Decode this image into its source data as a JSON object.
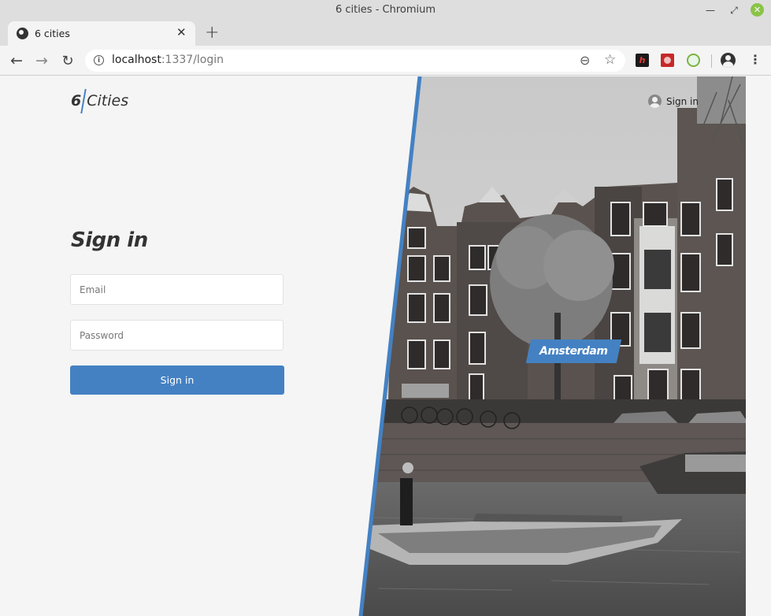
{
  "window": {
    "title": "6 cities - Chromium"
  },
  "tab": {
    "label": "6 cities",
    "close_glyph": "✕",
    "new_tab_glyph": "+"
  },
  "toolbar": {
    "back_glyph": "←",
    "forward_glyph": "→",
    "reload_glyph": "↻",
    "url_host": "localhost",
    "url_rest": ":1337/login",
    "zoom_glyph": "⊖",
    "bookmark_glyph": "☆",
    "menu_glyph": "⋮",
    "extension_1_letter": "h"
  },
  "page": {
    "logo": {
      "number": "6",
      "word": "Cities"
    },
    "header": {
      "sign_in_label": "Sign in"
    },
    "login": {
      "title": "Sign in",
      "email_placeholder": "Email",
      "password_placeholder": "Password",
      "submit_label": "Sign in"
    },
    "city": {
      "name": "Amsterdam"
    }
  },
  "colors": {
    "accent": "#4481c3",
    "background": "#f5f5f5"
  },
  "icons": [
    "globe-icon",
    "info-icon",
    "zoom-icon",
    "star-icon",
    "user-icon",
    "kebab-menu-icon"
  ]
}
